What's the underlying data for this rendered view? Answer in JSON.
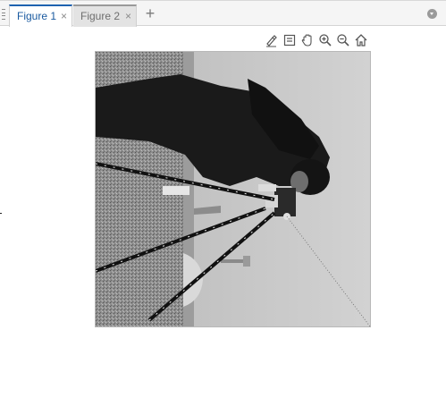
{
  "tabs": [
    {
      "label": "Figure 1",
      "close": "×",
      "active": true
    },
    {
      "label": "Figure 2",
      "close": "×",
      "active": false
    }
  ],
  "add_tab": "+",
  "toolbar": {
    "icons": [
      "brush-icon",
      "datatip-icon",
      "pan-icon",
      "zoom-in-icon",
      "zoom-out-icon",
      "home-icon"
    ]
  },
  "colors": {
    "active_tab_text": "#1a5aa0",
    "active_tab_accent": "#1e62b0",
    "inactive_tab_text": "#6e6e6e"
  }
}
